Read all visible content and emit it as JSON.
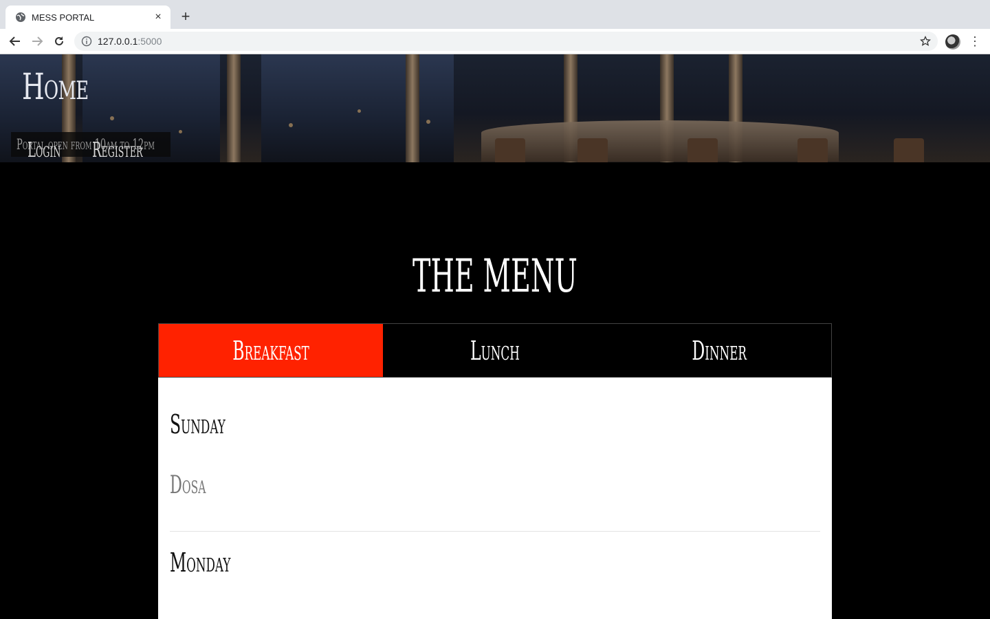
{
  "browser": {
    "tab_title": "MESS PORTAL",
    "new_tab": "+",
    "close": "×",
    "url_host": "127.0.0.1",
    "url_port": ":5000"
  },
  "hero": {
    "title": "Home",
    "notice": "Portal open from 10am to 12pm",
    "login": "Login",
    "register": "Register"
  },
  "menu": {
    "title": "THE MENU",
    "tabs": [
      {
        "label": "Breakfast",
        "active": true
      },
      {
        "label": "Lunch",
        "active": false
      },
      {
        "label": "Dinner",
        "active": false
      }
    ],
    "days": [
      {
        "day": "Sunday",
        "dish": "Dosa"
      },
      {
        "day": "Monday",
        "dish": ""
      }
    ]
  },
  "colors": {
    "active_tab": "#ff2200",
    "page_background": "#000000"
  }
}
